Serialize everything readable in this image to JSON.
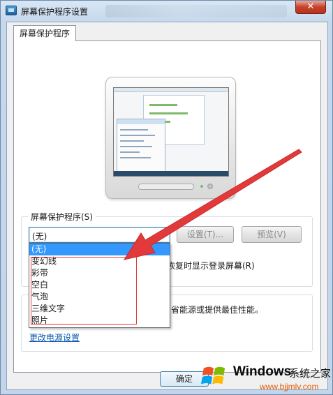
{
  "window": {
    "title": "屏幕保护程序设置",
    "close_glyph": "✕"
  },
  "tab": {
    "label": "屏幕保护程序"
  },
  "screensaver_group": {
    "label": "屏幕保护程序(S)",
    "selected": "(无)",
    "settings_button": "设置(T)...",
    "preview_button": "预览(V)",
    "resume_text": "恢复时显示登录屏幕(R)"
  },
  "dropdown": {
    "options": [
      "(无)",
      "变幻线",
      "彩带",
      "空白",
      "气泡",
      "三维文字",
      "照片"
    ],
    "selected_index": 0
  },
  "power_group": {
    "text": "省能源或提供最佳性能。",
    "link": "更改电源设置"
  },
  "footer": {
    "ok_button": "确定"
  },
  "watermark": {
    "brand": "Windows",
    "subtitle": "系统之家",
    "url": "www.bjjmlv.com"
  },
  "colors": {
    "accent": "#3399ff",
    "annotation_red": "#e23a3a",
    "link": "#0b58b0"
  }
}
